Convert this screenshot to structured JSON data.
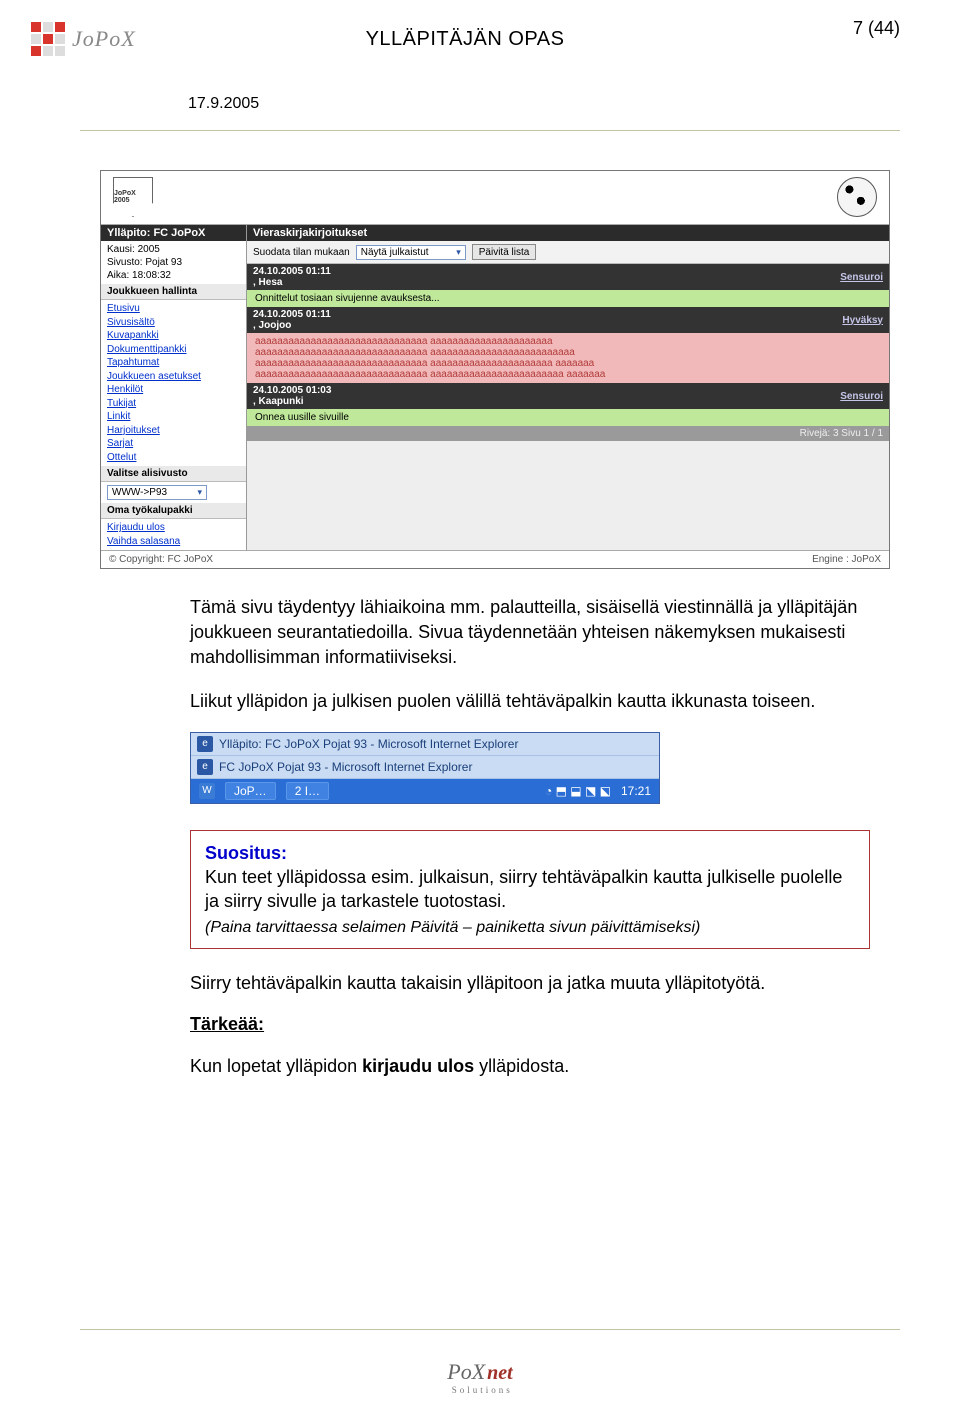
{
  "header": {
    "brand": "JoPoX",
    "title": "YLLÄPITÄJÄN OPAS",
    "page_number": "7 (44)",
    "date": "17.9.2005"
  },
  "screenshot": {
    "shield_text": "JoPoX 2005",
    "titlebar": "Ylläpito: FC JoPoX",
    "info": {
      "kausi": "Kausi: 2005",
      "sivusto": "Sivusto: Pojat 93",
      "aika": "Aika: 18:08:32"
    },
    "section_hallinta": "Joukkueen hallinta",
    "nav": [
      "Etusivu",
      "Sivusisältö",
      "Kuvapankki",
      "Dokumenttipankki",
      "Tapahtumat",
      "Joukkueen asetukset",
      "Henkilöt",
      "Tukijat",
      "Linkit",
      "Harjoitukset",
      "Sarjat",
      "Ottelut"
    ],
    "section_alisivusto": "Valitse alisivusto",
    "alisivusto_value": "WWW->P93",
    "section_tyokalupakki": "Oma työkalupakki",
    "tool_links": [
      "Kirjaudu ulos",
      "Vaihda salasana"
    ],
    "main_title": "Vieraskirjakirjoitukset",
    "filter_label": "Suodata tilan mukaan",
    "filter_value": "Näytä julkaistut",
    "btn_paivita": "Päivitä lista",
    "entries": [
      {
        "meta": "24.10.2005 01:11",
        "author": ", Hesa",
        "action": "Sensuroi",
        "body": "Onnittelut tosiaan sivujenne avauksesta...",
        "tone": "green"
      },
      {
        "meta": "24.10.2005 01:11",
        "author": ", Joojoo",
        "action": "Hyväksy",
        "body": "aaaaaaaaaaaaaaaaaaaaaaaaaaaaaaa aaaaaaaaaaaaaaaaaaaaaa\naaaaaaaaaaaaaaaaaaaaaaaaaaaaaaa aaaaaaaaaaaaaaaaaaaaaaaaaa\naaaaaaaaaaaaaaaaaaaaaaaaaaaaaaa aaaaaaaaaaaaaaaaaaaaaa aaaaaaa\naaaaaaaaaaaaaaaaaaaaaaaaaaaaaaa aaaaaaaaaaaaaaaaaaaaaaaa aaaaaaa",
        "tone": "pink"
      },
      {
        "meta": "24.10.2005 01:03",
        "author": ", Kaapunki",
        "action": "Sensuroi",
        "body": "Onnea uusille sivuille",
        "tone": "green"
      }
    ],
    "pager": "Rivejä: 3  Sivu 1 / 1",
    "footer_left": "© Copyright: FC JoPoX",
    "footer_right": "Engine : JoPoX"
  },
  "body_paragraphs": [
    "Tämä sivu täydentyy lähiaikoina mm. palautteilla, sisäisellä viestinnällä ja ylläpitäjän joukkueen seurantatiedoilla. Sivua täydennetään yhteisen näkemyksen mukaisesti mahdollisimman informatiiviseksi.",
    "Liikut ylläpidon ja julkisen puolen välillä tehtäväpalkin kautta ikkunasta toiseen."
  ],
  "taskbar": {
    "row1": "Ylläpito: FC JoPoX Pojat 93 - Microsoft Internet Explorer",
    "row2": "FC JoPoX Pojat 93 - Microsoft Internet Explorer",
    "btn1": "JoP…",
    "btn2": "2 I…",
    "time": "17:21"
  },
  "callout": {
    "title": "Suositus:",
    "line1": "Kun teet ylläpidossa esim. julkaisun, siirry tehtäväpalkin kautta julkiselle puolelle ja siirry sivulle ja tarkastele tuotostasi.",
    "line2": "(Paina tarvittaessa selaimen Päivitä – painiketta sivun päivittämiseksi)"
  },
  "after": {
    "p1": "Siirry tehtäväpalkin kautta takaisin ylläpitoon ja jatka muuta ylläpitotyötä.",
    "heading": "Tärkeää:",
    "p2_pre": "Kun lopetat ylläpidon ",
    "p2_bold": "kirjaudu ulos",
    "p2_post": " ylläpidosta."
  },
  "footer": {
    "brand": "PoX",
    "net": "net",
    "sub": "Solutions"
  }
}
